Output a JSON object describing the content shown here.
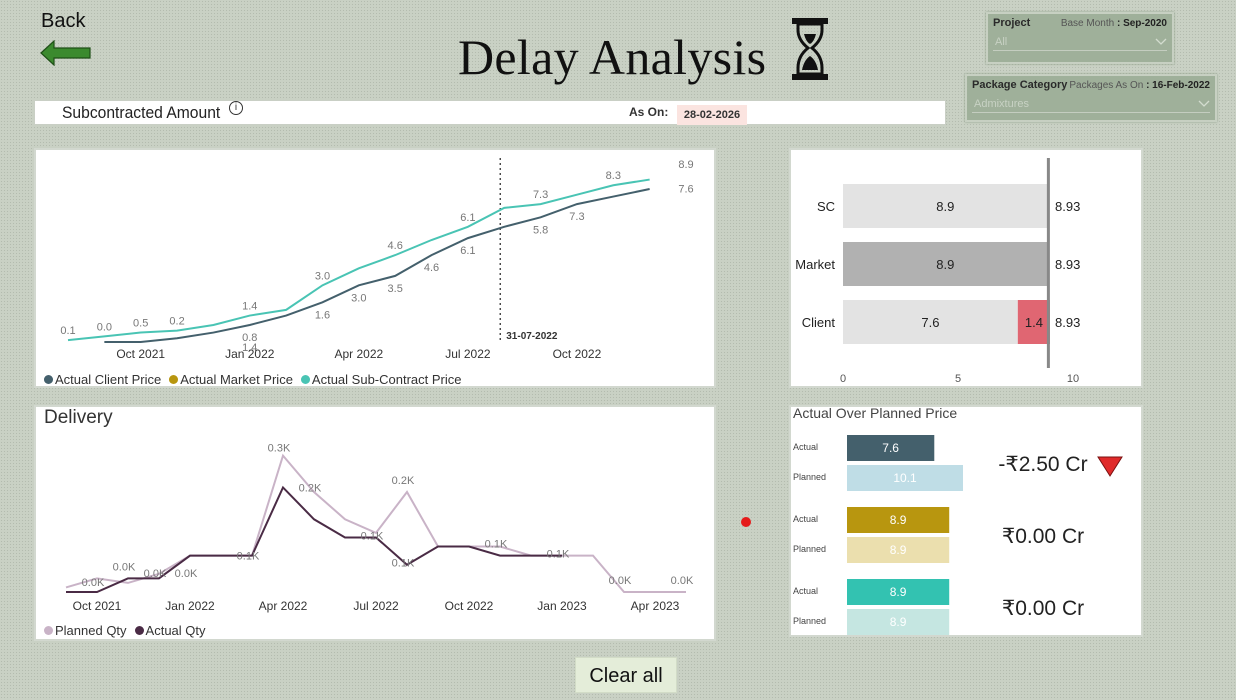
{
  "nav": {
    "back_label": "Back"
  },
  "header": {
    "title": "Delay Analysis"
  },
  "filters": {
    "project": {
      "label": "Project",
      "base_month_label": "Base Month",
      "base_month_value": ": Sep-2020",
      "selected": "All"
    },
    "package_category": {
      "label": "Package Category",
      "as_on_label": "Packages As On",
      "as_on_value": ": 16-Feb-2022",
      "selected": "Admixtures"
    }
  },
  "subcontract": {
    "title": "Subcontracted Amount",
    "info": "i",
    "as_on_label": "As On:",
    "as_on_value": "28-02-2026"
  },
  "colors": {
    "client": "#44606c",
    "market": "#b8960f",
    "subcontract": "#49c4b4",
    "planned_qty": "#c9b3c7",
    "actual_qty": "#4a2b45",
    "delta_negative": "#e06672",
    "trend_down": "#e02a2a"
  },
  "chart_data": [
    {
      "id": "price_trend",
      "type": "line",
      "x_ticks": [
        "Oct 2021",
        "Jan 2022",
        "Apr 2022",
        "Jul 2022",
        "Oct 2022"
      ],
      "reference_line": {
        "label": "31-07-2022"
      },
      "series": [
        {
          "name": "Actual Client Price",
          "color": "#44606c",
          "x": [
            "Sep 2021",
            "Oct 2021",
            "Nov 2021",
            "Dec 2021",
            "Jan 2022",
            "Feb 2022",
            "Mar 2022",
            "Apr 2022",
            "May 2022",
            "Jun 2022",
            "Jul 2022",
            "Aug 2022",
            "Sep 2022",
            "Oct 2022",
            "Nov 2022",
            "Dec 2022"
          ],
          "values": [
            0.0,
            0.0,
            0.2,
            0.5,
            0.9,
            1.4,
            2.1,
            3.0,
            3.5,
            4.6,
            5.5,
            6.1,
            6.6,
            7.3,
            7.7,
            8.1
          ]
        },
        {
          "name": "Actual Market Price",
          "color": "#b8960f",
          "x": [],
          "values": []
        },
        {
          "name": "Actual Sub-Contract Price",
          "color": "#49c4b4",
          "x": [
            "Aug 2021",
            "Sep 2021",
            "Oct 2021",
            "Nov 2021",
            "Dec 2021",
            "Jan 2022",
            "Feb 2022",
            "Mar 2022",
            "Apr 2022",
            "May 2022",
            "Jun 2022",
            "Jul 2022",
            "Aug 2022",
            "Sep 2022",
            "Oct 2022",
            "Nov 2022",
            "Dec 2022"
          ],
          "values": [
            0.1,
            0.3,
            0.5,
            0.6,
            0.9,
            1.4,
            1.7,
            3.0,
            3.9,
            4.6,
            5.4,
            6.1,
            7.1,
            7.3,
            7.8,
            8.3,
            8.6
          ]
        }
      ],
      "data_labels": [
        {
          "x": "Aug 2021",
          "v": "0.1"
        },
        {
          "x": "Sep 2021",
          "v": "0.0"
        },
        {
          "x": "Oct 2021",
          "v": "0.5"
        },
        {
          "x": "Nov 2021",
          "v": "0.2"
        },
        {
          "x": "Jan 2022",
          "v": "1.4"
        },
        {
          "x": "Jan 2022",
          "v": "0.8",
          "low": true
        },
        {
          "x": "Jan 2022",
          "v": "1.4",
          "low2": true
        },
        {
          "x": "Mar 2022",
          "v": "3.0"
        },
        {
          "x": "Mar 2022",
          "v": "1.6",
          "low": true
        },
        {
          "x": "Apr 2022",
          "v": "3.0",
          "low": true
        },
        {
          "x": "May 2022",
          "v": "4.6"
        },
        {
          "x": "May 2022",
          "v": "3.5",
          "low": true
        },
        {
          "x": "Jun 2022",
          "v": "4.6",
          "low": true
        },
        {
          "x": "Jul 2022",
          "v": "6.1"
        },
        {
          "x": "Jul 2022",
          "v": "6.1",
          "low": true
        },
        {
          "x": "Sep 2022",
          "v": "7.3"
        },
        {
          "x": "Sep 2022",
          "v": "5.8",
          "low": true
        },
        {
          "x": "Oct 2022",
          "v": "7.3",
          "low": true
        },
        {
          "x": "Nov 2022",
          "v": "8.3"
        },
        {
          "x": "Jan 2023",
          "v": "8.9"
        },
        {
          "x": "Jan 2023",
          "v": "7.6",
          "low": true
        }
      ]
    },
    {
      "id": "price_compare",
      "type": "bar",
      "orientation": "horizontal",
      "categories": [
        "SC",
        "Market",
        "Client"
      ],
      "values": [
        8.9,
        8.9,
        7.6
      ],
      "extra": [
        0,
        0,
        1.4
      ],
      "totals": [
        "8.93",
        "8.93",
        "8.93"
      ],
      "xlim": [
        0,
        10
      ],
      "x_ticks": [
        "0",
        "5",
        "10"
      ],
      "reference_value": 8.93,
      "bar_colors": [
        "#e3e3e3",
        "#b1b1b1",
        "#e3e3e3"
      ]
    },
    {
      "id": "delivery",
      "title": "Delivery",
      "type": "line",
      "x_ticks": [
        "Oct 2021",
        "Jan 2022",
        "Apr 2022",
        "Jul 2022",
        "Oct 2022",
        "Jan 2023",
        "Apr 2023"
      ],
      "series": [
        {
          "name": "Planned Qty",
          "color": "#c9b3c7",
          "values": [
            0.01,
            0.03,
            0.02,
            0.04,
            0.08,
            0.08,
            0.08,
            0.3,
            0.22,
            0.16,
            0.13,
            0.22,
            0.1,
            0.1,
            0.1,
            0.08,
            0.08,
            0.08,
            0.0,
            0.0,
            0.0
          ]
        },
        {
          "name": "Actual Qty",
          "color": "#4a2b45",
          "values": [
            0.0,
            0.0,
            0.03,
            0.03,
            0.08,
            0.08,
            0.08,
            0.23,
            0.16,
            0.12,
            0.12,
            0.06,
            0.1,
            0.1,
            0.08,
            0.08,
            0.08,
            null,
            null,
            null,
            null
          ]
        }
      ],
      "data_labels": [
        "0.0K",
        "0.0K",
        "0.0K",
        "0.0K",
        "0.1K",
        "0.3K",
        "0.2K",
        "0.1K",
        "0.2K",
        "0.1K",
        "0.1K",
        "0.1K",
        "0.0K",
        "0.0K"
      ]
    },
    {
      "id": "actual_over_planned",
      "title": "Actual Over Planned Price",
      "type": "bar",
      "groups": [
        {
          "actual_label": "Actual",
          "planned_label": "Planned",
          "actual": 7.6,
          "planned": 10.1,
          "actual_text": "7.6",
          "planned_text": "10.1",
          "delta": "-₹2.50 Cr",
          "trend": "down",
          "actual_color": "#44606c",
          "planned_color": "#bfdde6"
        },
        {
          "actual_label": "Actual",
          "planned_label": "Planned",
          "actual": 8.9,
          "planned": 8.9,
          "actual_text": "8.9",
          "planned_text": "8.9",
          "delta": "₹0.00 Cr",
          "trend": "flat",
          "actual_color": "#b8960f",
          "planned_color": "#ebdfae"
        },
        {
          "actual_label": "Actual",
          "planned_label": "Planned",
          "actual": 8.9,
          "planned": 8.9,
          "actual_text": "8.9",
          "planned_text": "8.9",
          "delta": "₹0.00 Cr",
          "trend": "flat",
          "actual_color": "#33c2b1",
          "planned_color": "#c5e6e1"
        }
      ]
    }
  ],
  "actions": {
    "clear_all_label": "Clear all"
  }
}
